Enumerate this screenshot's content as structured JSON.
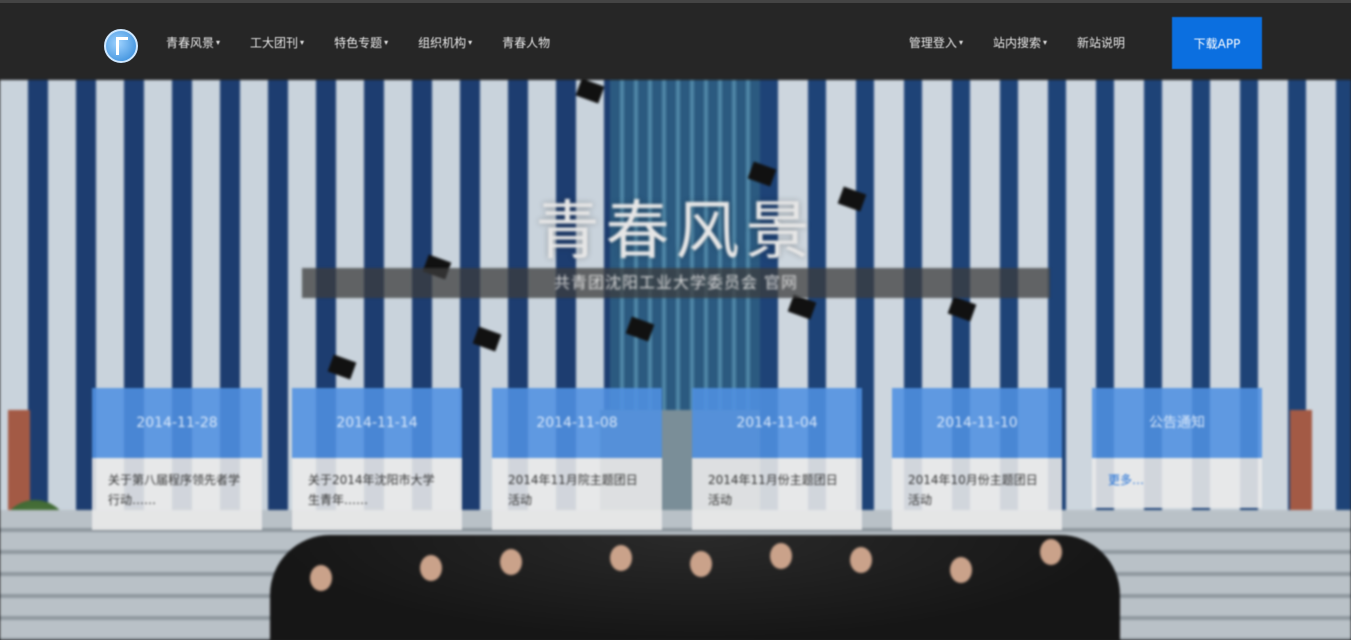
{
  "header": {
    "nav_left": [
      {
        "label": "青春风景",
        "caret": "▾"
      },
      {
        "label": "工大团刊",
        "caret": "▾"
      },
      {
        "label": "特色专题",
        "caret": "▾"
      },
      {
        "label": "组织机构",
        "caret": "▾"
      },
      {
        "label": "青春人物",
        "caret": ""
      }
    ],
    "nav_right": [
      {
        "label": "管理登入",
        "caret": "▾"
      },
      {
        "label": "站内搜索",
        "caret": "▾"
      },
      {
        "label": "新站说明",
        "caret": ""
      }
    ],
    "download_label": "下载APP"
  },
  "hero": {
    "title": "青春风景",
    "subtitle": "共青团沈阳工业大学委员会 官网"
  },
  "cards": [
    {
      "date": "2014-11-28",
      "text": "关于第八届程序领先者学行动……"
    },
    {
      "date": "2014-11-14",
      "text": "关于2014年沈阳市大学生青年……"
    },
    {
      "date": "2014-11-08",
      "text": "2014年11月院主题团日活动"
    },
    {
      "date": "2014-11-04",
      "text": "2014年11月份主题团日活动"
    },
    {
      "date": "2014-11-10",
      "text": "2014年10月份主题团日活动"
    },
    {
      "date": "公告通知",
      "text": "更多…"
    }
  ],
  "colors": {
    "header_bg": "#262626",
    "accent": "#0b6fe0",
    "card_header": "#5091e1"
  }
}
